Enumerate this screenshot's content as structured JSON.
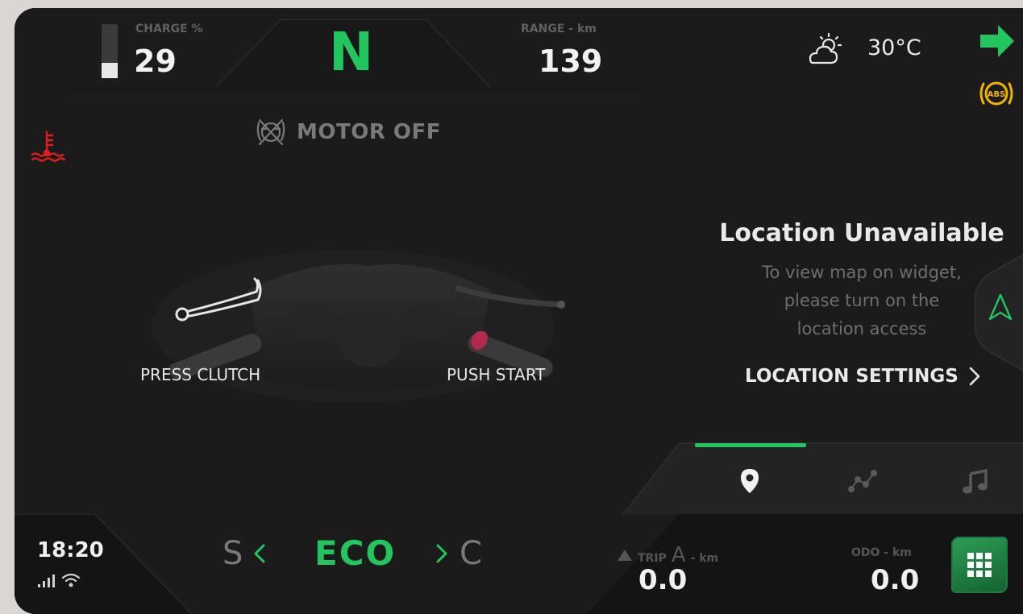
{
  "top": {
    "charge_label": "CHARGE %",
    "charge_value": "29",
    "charge_fraction": 0.29,
    "gear": "N",
    "range_label": "RANGE - km",
    "range_value": "139",
    "temperature": "30°C"
  },
  "status": {
    "motor": "MOTOR OFF"
  },
  "hints": {
    "press_clutch": "PRESS CLUTCH",
    "push_start": "PUSH START"
  },
  "location": {
    "title": "Location Unavailable",
    "line1": "To view map on widget,",
    "line2": "please turn on the",
    "line3": "location access",
    "settings_label": "LOCATION SETTINGS"
  },
  "bottom": {
    "time": "18:20",
    "mode_left": "S",
    "mode_current": "ECO",
    "mode_right": "C",
    "trip_word": "TRIP",
    "trip_letter": "A",
    "trip_unit": "- km",
    "trip_value": "0.0",
    "odo_label": "ODO - km",
    "odo_value": "0.0"
  },
  "icons": {
    "abs_text": "ABS"
  },
  "colors": {
    "accent_green": "#22c55e",
    "warning_red": "#e11d1d",
    "abs_amber": "#f0b400"
  }
}
